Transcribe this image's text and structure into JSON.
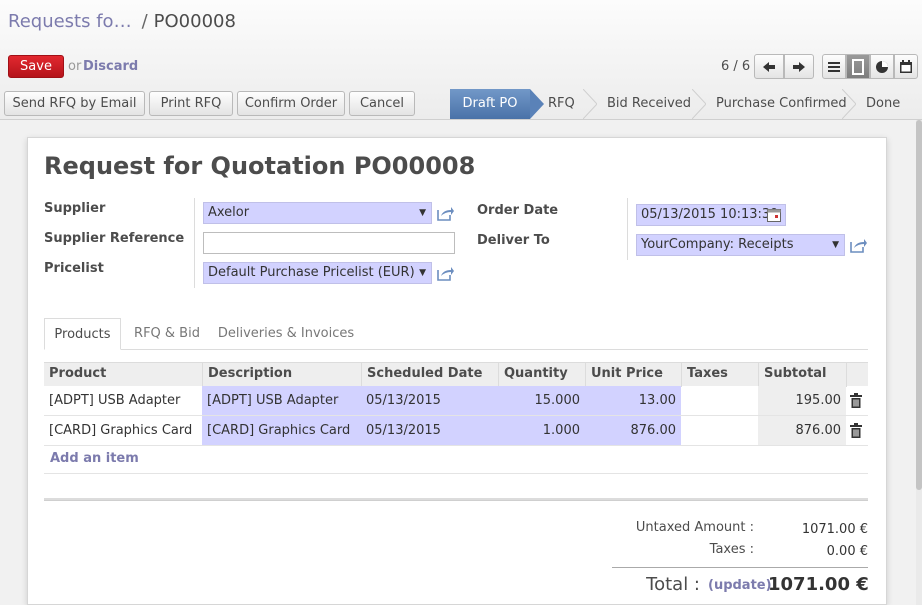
{
  "breadcrumb": {
    "parent": "Requests fo…",
    "separator": "/",
    "current": "PO00008"
  },
  "toolbar": {
    "save_label": "Save",
    "or_text": "or",
    "discard_label": "Discard"
  },
  "pager": {
    "text": "6 / 6"
  },
  "view_switcher": {
    "icons": [
      "list-view-icon",
      "form-view-icon",
      "graph-view-icon",
      "calendar-view-icon"
    ],
    "active": "form-view-icon"
  },
  "actions": {
    "send_rfq": "Send RFQ by Email",
    "print_rfq": "Print RFQ",
    "confirm_order": "Confirm Order",
    "cancel": "Cancel"
  },
  "statusbar": {
    "stages": [
      "Draft PO",
      "RFQ",
      "Bid Received",
      "Purchase Confirmed",
      "Done"
    ],
    "active": "Draft PO"
  },
  "form": {
    "title_prefix": "Request for Quotation",
    "title_ref": "PO00008",
    "supplier_label": "Supplier",
    "supplier_value": "Axelor",
    "supplier_ref_label": "Supplier Reference",
    "supplier_ref_value": "",
    "pricelist_label": "Pricelist",
    "pricelist_value": "Default Purchase Pricelist (EUR)",
    "order_date_label": "Order Date",
    "order_date_value": "05/13/2015 10:13:39",
    "deliver_to_label": "Deliver To",
    "deliver_to_value": "YourCompany: Receipts"
  },
  "tabs": [
    "Products",
    "RFQ & Bid",
    "Deliveries & Invoices"
  ],
  "lines": {
    "headers": [
      "Product",
      "Description",
      "Scheduled Date",
      "Quantity",
      "Unit Price",
      "Taxes",
      "Subtotal"
    ],
    "rows": [
      {
        "product": "[ADPT] USB Adapter",
        "description": "[ADPT] USB Adapter",
        "date": "05/13/2015",
        "qty": "15.000",
        "price": "13.00",
        "taxes": "",
        "subtotal": "195.00"
      },
      {
        "product": "[CARD] Graphics Card",
        "description": "[CARD] Graphics Card",
        "date": "05/13/2015",
        "qty": "1.000",
        "price": "876.00",
        "taxes": "",
        "subtotal": "876.00"
      }
    ],
    "add_item": "Add an item"
  },
  "totals": {
    "untaxed_label": "Untaxed Amount :",
    "untaxed_value": "1071.00 €",
    "taxes_label": "Taxes :",
    "taxes_value": "0.00 €",
    "total_label": "Total :",
    "update_label": "(update)",
    "total_value": "1071.00 €"
  },
  "colors": {
    "accent": "#7c7bad",
    "save": "#d1232b",
    "status_active": "#5a82b8",
    "editable_field": "#d2d2ff"
  }
}
